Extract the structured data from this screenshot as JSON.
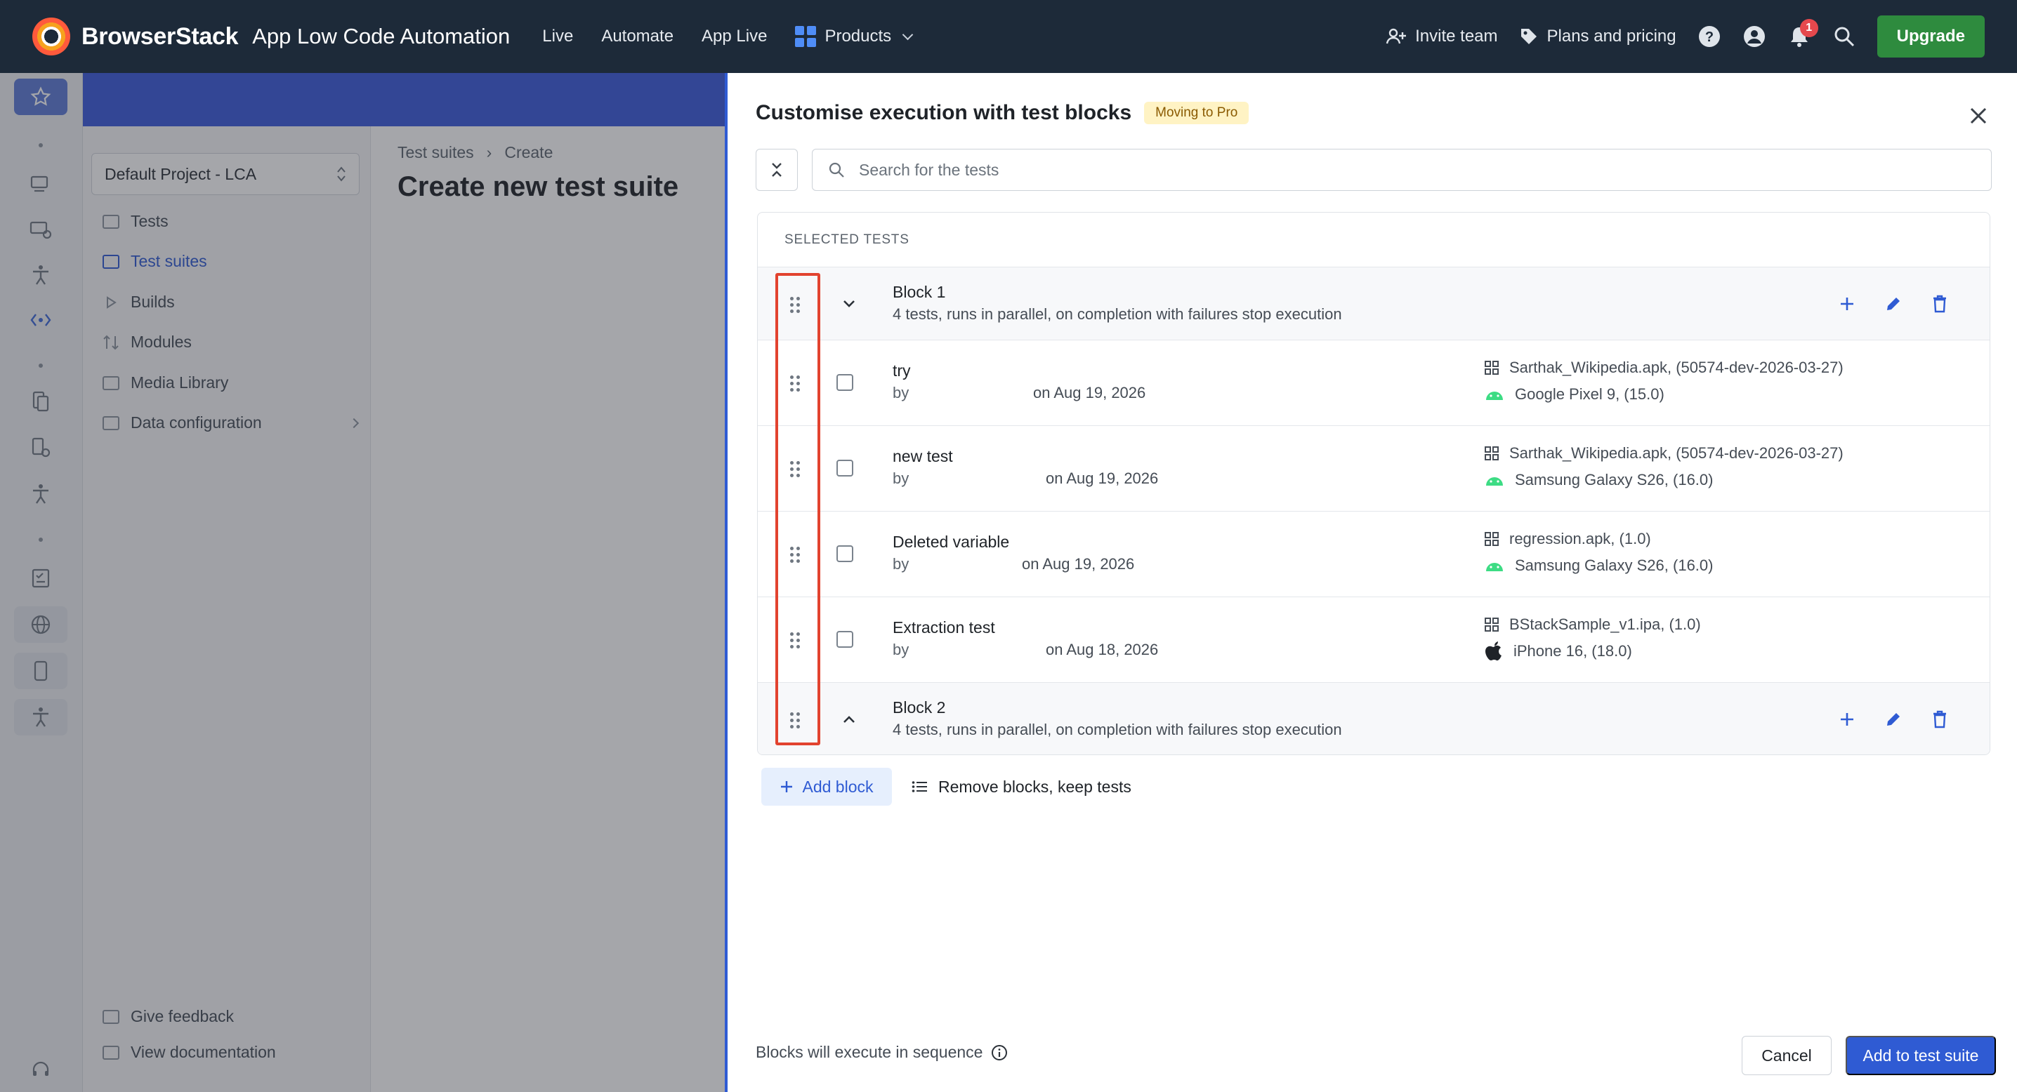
{
  "topnav": {
    "brand_name": "BrowserStack",
    "product_name": "App Low Code Automation",
    "links": [
      "Live",
      "Automate",
      "App Live"
    ],
    "products_label": "Products",
    "invite_label": "Invite team",
    "pricing_label": "Plans and pricing",
    "notification_count": "1",
    "upgrade_label": "Upgrade",
    "icons": [
      "help-icon",
      "account-icon",
      "bell-icon",
      "search-icon"
    ]
  },
  "background": {
    "project_select": "Default Project - LCA",
    "nav": [
      {
        "label": "Tests"
      },
      {
        "label": "Test suites",
        "active": true
      },
      {
        "label": "Builds"
      },
      {
        "label": "Modules"
      },
      {
        "label": "Media Library"
      },
      {
        "label": "Data configuration"
      }
    ],
    "breadcrumb": [
      "Test suites",
      "Create"
    ],
    "page_title": "Create new test suite",
    "footer_links": [
      "Give feedback",
      "View documentation"
    ]
  },
  "drawer": {
    "title": "Customise execution with test blocks",
    "badge": "Moving to Pro",
    "search_placeholder": "Search for the tests",
    "section_header": "SELECTED TESTS",
    "blocks": [
      {
        "name": "Block 1",
        "meta": "4 tests, runs in parallel, on completion with failures stop execution",
        "expanded": true
      },
      {
        "name": "Block 2",
        "meta": "4 tests, runs in parallel, on completion with failures stop execution",
        "expanded": false
      }
    ],
    "tests": [
      {
        "name": "try",
        "by": "by",
        "date": "on Aug 19, 2026",
        "app": "Sarthak_Wikipedia.apk, (50574-dev-2026-03-27)",
        "device": "Google Pixel 9, (15.0)",
        "platform": "android"
      },
      {
        "name": "new test",
        "by": "by",
        "date": "on Aug 19, 2026",
        "app": "Sarthak_Wikipedia.apk, (50574-dev-2026-03-27)",
        "device": "Samsung Galaxy S26, (16.0)",
        "platform": "android"
      },
      {
        "name": "Deleted variable",
        "by": "by",
        "date": "on Aug 19, 2026",
        "app": "regression.apk, (1.0)",
        "device": "Samsung Galaxy S26, (16.0)",
        "platform": "android"
      },
      {
        "name": "Extraction test",
        "by": "by",
        "date": "on Aug 18, 2026",
        "app": "BStackSample_v1.ipa, (1.0)",
        "device": "iPhone 16, (18.0)",
        "platform": "ios"
      }
    ],
    "add_block_label": "Add block",
    "remove_blocks_label": "Remove blocks, keep tests",
    "footer_note": "Blocks will execute in sequence",
    "cancel_label": "Cancel",
    "submit_label": "Add to test suite"
  },
  "colors": {
    "nav_bg": "#1d2a39",
    "accent": "#2f5bd3",
    "upgrade": "#2e8b3e",
    "highlight": "#e2432f",
    "android": "#3ddc84"
  }
}
